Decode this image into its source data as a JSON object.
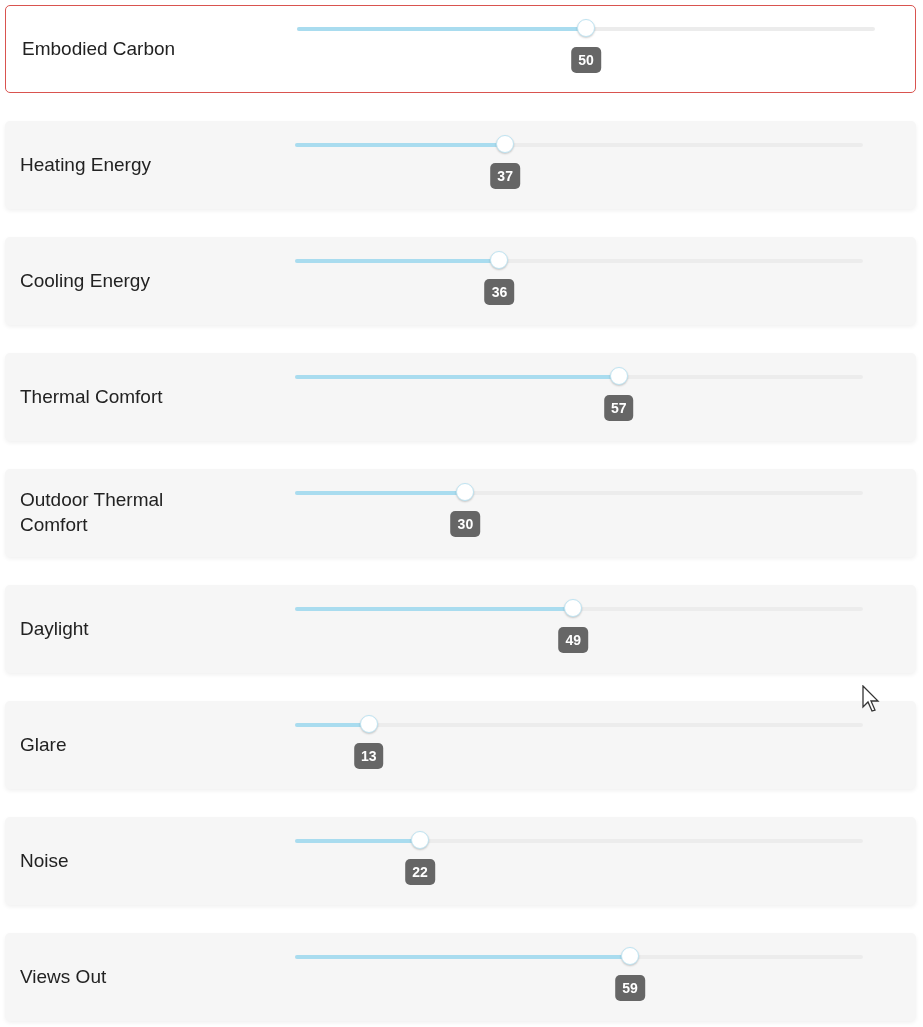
{
  "sliders": [
    {
      "label": "Embodied Carbon",
      "value": "50",
      "level": 0.5,
      "selected": true
    },
    {
      "label": "Heating Energy",
      "value": "37",
      "level": 0.37,
      "selected": false
    },
    {
      "label": "Cooling Energy",
      "value": "36",
      "level": 0.36,
      "selected": false
    },
    {
      "label": "Thermal Comfort",
      "value": "57",
      "level": 0.57,
      "selected": false
    },
    {
      "label": "Outdoor Thermal Comfort",
      "value": "30",
      "level": 0.3,
      "selected": false
    },
    {
      "label": "Daylight",
      "value": "49",
      "level": 0.49,
      "selected": false
    },
    {
      "label": "Glare",
      "value": "13",
      "level": 0.13,
      "selected": false
    },
    {
      "label": "Noise",
      "value": "22",
      "level": 0.22,
      "selected": false
    },
    {
      "label": "Views Out",
      "value": "59",
      "level": 0.59,
      "selected": false
    }
  ]
}
